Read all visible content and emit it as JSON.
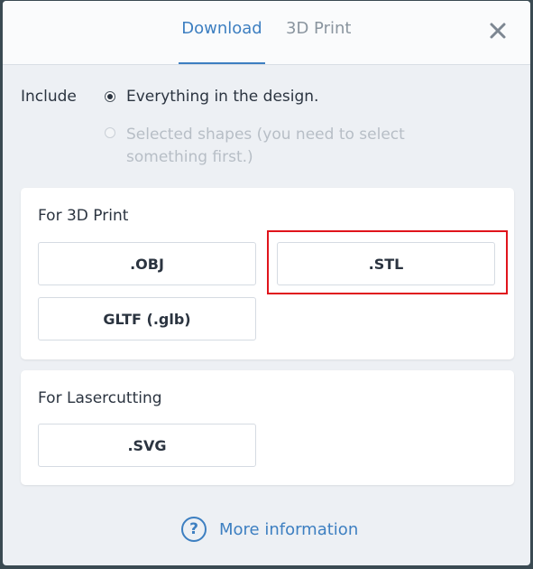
{
  "tabs": {
    "download": "Download",
    "print3d": "3D Print"
  },
  "close_icon": "close-icon",
  "include": {
    "label": "Include",
    "option_all": "Everything in the design.",
    "option_selected": "Selected shapes (you need to select something first.)",
    "selected_option": "Everything in the design."
  },
  "print3d_section": {
    "title": "For 3D Print",
    "buttons": [
      ".OBJ",
      ".STL",
      "GLTF (.glb)"
    ]
  },
  "laser_section": {
    "title": "For Lasercutting",
    "buttons": [
      ".SVG"
    ]
  },
  "more_info": {
    "icon": "help-circle-icon",
    "label": "More information"
  },
  "colors": {
    "accent": "#3d7fc1",
    "highlight": "#e0141c",
    "panel_bg": "#edf0f4"
  }
}
